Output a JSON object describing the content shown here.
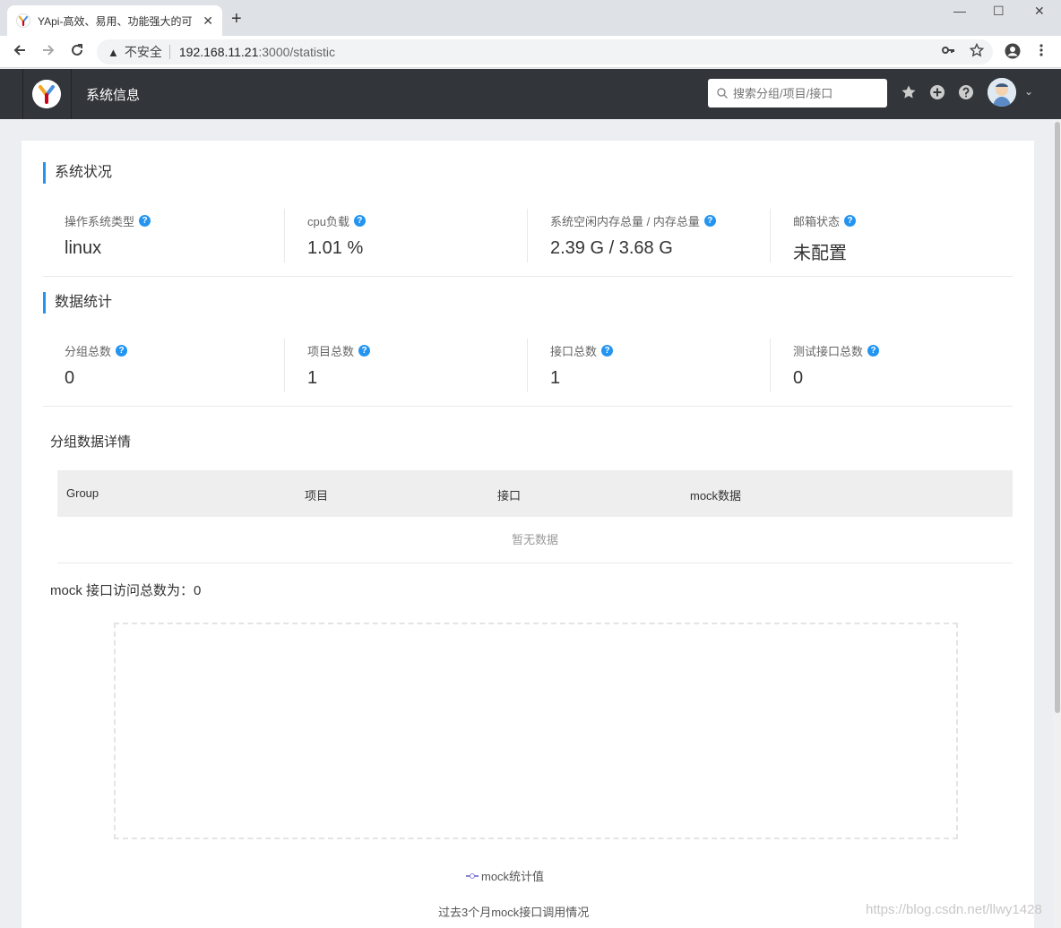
{
  "browser": {
    "tab_title": "YApi-高效、易用、功能强大的可",
    "tab_close": "✕",
    "new_tab": "+",
    "insecure_label": "不安全",
    "url_host": "192.168.11.21",
    "url_path": ":3000/statistic",
    "window_controls": {
      "minimize": "—",
      "maximize": "☐",
      "close": "✕"
    }
  },
  "header": {
    "title": "系统信息",
    "search_placeholder": "搜索分组/项目/接口"
  },
  "system_status": {
    "title": "系统状况",
    "items": [
      {
        "label": "操作系统类型",
        "value": "linux"
      },
      {
        "label": "cpu负载",
        "value": "1.01 %"
      },
      {
        "label": "系统空闲内存总量 / 内存总量",
        "value": "2.39 G / 3.68 G"
      },
      {
        "label": "邮箱状态",
        "value": "未配置"
      }
    ]
  },
  "data_stats": {
    "title": "数据统计",
    "items": [
      {
        "label": "分组总数",
        "value": "0"
      },
      {
        "label": "项目总数",
        "value": "1"
      },
      {
        "label": "接口总数",
        "value": "1"
      },
      {
        "label": "测试接口总数",
        "value": "0"
      }
    ]
  },
  "group_details": {
    "title": "分组数据详情",
    "columns": [
      "Group",
      "项目",
      "接口",
      "mock数据"
    ],
    "empty_text": "暂无数据"
  },
  "mock": {
    "total_text": "mock 接口访问总数为：0",
    "legend": "mock统计值",
    "caption": "过去3个月mock接口调用情况"
  },
  "watermark": "https://blog.csdn.net/llwy1428"
}
